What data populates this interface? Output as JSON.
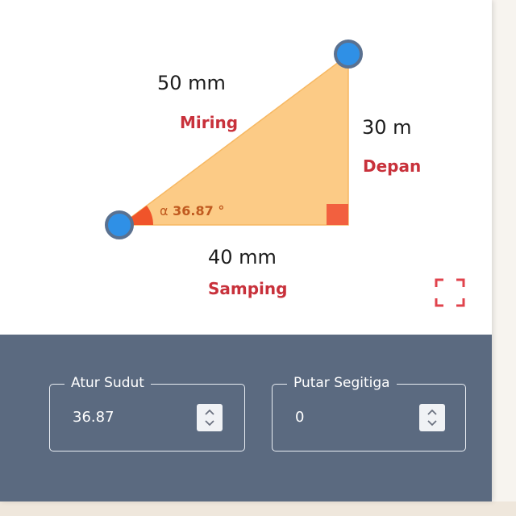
{
  "triangle": {
    "hypotenuse": {
      "length": "50 mm",
      "name": "Miring"
    },
    "opposite": {
      "length": "30 m",
      "name": "Depan"
    },
    "adjacent": {
      "length": "40 mm",
      "name": "Samping"
    },
    "angle": {
      "symbol": "α",
      "value": "36.87",
      "unit": "°"
    }
  },
  "controls": {
    "set_angle": {
      "label": "Atur Sudut",
      "value": "36.87"
    },
    "rotate": {
      "label": "Putar Segitiga",
      "value": "0"
    }
  },
  "colors": {
    "triangle_fill": "#fccb86",
    "angle_marker": "#f0542a",
    "right_angle_marker": "#f2603f",
    "vertex_handle": "#2f90e6",
    "label_red": "#c8313b",
    "panel_bg": "#5b6a80"
  },
  "icons": {
    "fullscreen": "fullscreen-corners-icon",
    "spinner": "up-down-chevron-icon"
  }
}
